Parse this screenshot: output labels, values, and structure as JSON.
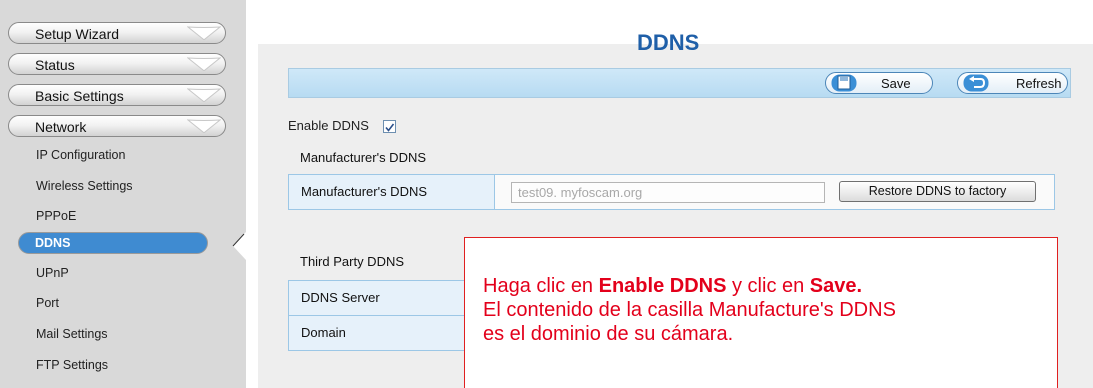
{
  "sidebar": {
    "menus": [
      {
        "label": "Setup Wizard"
      },
      {
        "label": "Status"
      },
      {
        "label": "Basic Settings"
      },
      {
        "label": "Network"
      }
    ],
    "network_items": [
      {
        "label": "IP Configuration"
      },
      {
        "label": "Wireless Settings"
      },
      {
        "label": "PPPoE"
      },
      {
        "label": "DDNS",
        "selected": true
      },
      {
        "label": "UPnP"
      },
      {
        "label": "Port"
      },
      {
        "label": "Mail Settings"
      },
      {
        "label": "FTP Settings"
      }
    ]
  },
  "main": {
    "title": "DDNS",
    "toolbar": {
      "save_label": "Save",
      "refresh_label": "Refresh",
      "save_icon": "floppy-disk-icon",
      "refresh_icon": "refresh-arrow-icon"
    },
    "enable_ddns": {
      "label": "Enable DDNS",
      "checked": true
    },
    "manufacturer_section": "Manufacturer's DDNS",
    "manufacturer_row": {
      "label": "Manufacturer's DDNS",
      "value": "test09. myfoscam.org",
      "restore_label": "Restore DDNS to factory"
    },
    "third_party_section": "Third Party DDNS",
    "third_party_rows": [
      {
        "label": "DDNS Server"
      },
      {
        "label": "Domain"
      }
    ]
  },
  "annotation": {
    "line1_prefix": "Haga clic en ",
    "line1_bold1": "Enable DDNS",
    "line1_middle": " y clic en ",
    "line1_bold2": "Save.",
    "line2": "El contenido de la casilla Manufacture's DDNS",
    "line3": "es el dominio de su cámara."
  },
  "colors": {
    "accent_title": "#1f5fa8",
    "selected_item": "#3f8bd1",
    "note_text": "#e3001b",
    "note_border": "#e02020"
  }
}
